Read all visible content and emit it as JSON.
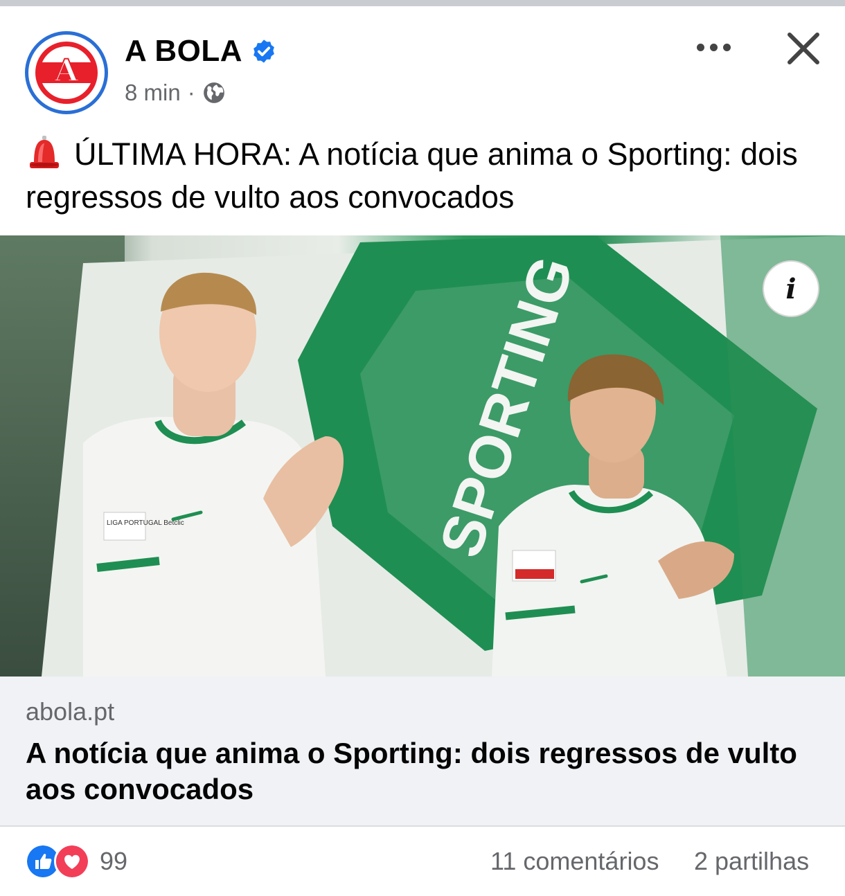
{
  "post": {
    "page_name": "A BOLA",
    "avatar_letter": "A",
    "timestamp": "8 min",
    "separator": "·",
    "audience_icon": "globe-icon",
    "verified_icon": "verified-badge-icon",
    "text_icon": "rotating-light-emoji",
    "text": "ÚLTIMA HORA: A notícia que anima o Sporting: dois regressos de vulto aos convocados"
  },
  "header_actions": {
    "more_icon": "more-horizontal-icon",
    "close_icon": "close-icon"
  },
  "image": {
    "info_button_label": "i",
    "jersey_badge_text": "LIGA PORTUGAL Betclic",
    "flag_text": "SPORTING"
  },
  "link_preview": {
    "domain": "abola.pt",
    "title": "A notícia que anima o Sporting: dois regressos de vulto aos convocados"
  },
  "footer": {
    "reaction_icons": [
      "like-icon",
      "love-icon"
    ],
    "reaction_count": "99",
    "comments": "11 comentários",
    "shares": "2 partilhas"
  },
  "colors": {
    "verified_blue": "#1877f2",
    "like_blue": "#1877f2",
    "love_red": "#f33e58",
    "brand_red": "#e8202b",
    "sporting_green": "#1e8a4e",
    "secondary_text": "#65676b",
    "link_box_bg": "#f0f2f5"
  }
}
